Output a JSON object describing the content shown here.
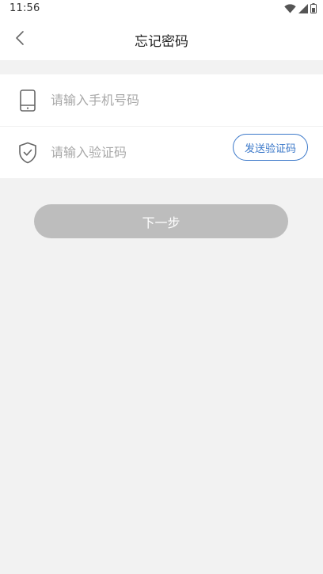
{
  "status_bar": {
    "time": "11:56",
    "icons": [
      "wifi-icon",
      "cellular-signal-icon",
      "battery-icon"
    ]
  },
  "header": {
    "title": "忘记密码",
    "back_icon": "chevron-left-icon"
  },
  "form": {
    "phone": {
      "icon": "phone-icon",
      "placeholder": "请输入手机号码",
      "value": ""
    },
    "code": {
      "icon": "shield-check-icon",
      "placeholder": "请输入验证码",
      "value": "",
      "send_button_label": "发送验证码"
    }
  },
  "next_button_label": "下一步",
  "colors": {
    "accent": "#3b78c9",
    "disabled_button": "#bdbdbd",
    "background": "#f2f2f2"
  }
}
